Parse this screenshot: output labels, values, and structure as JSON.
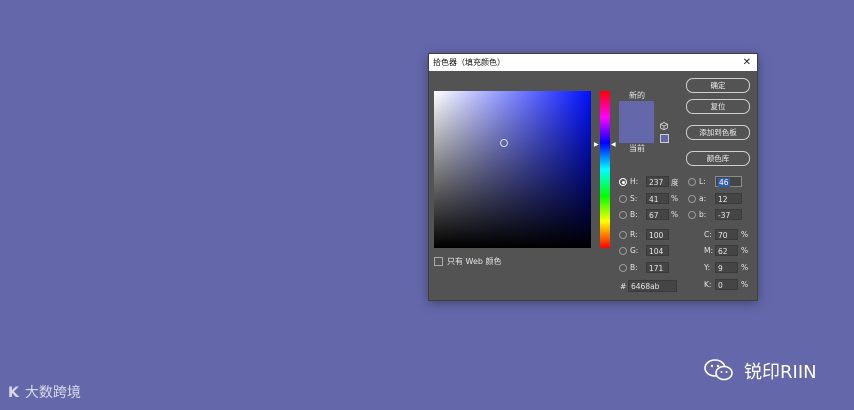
{
  "dialog": {
    "title": "拾色器（填充颜色）",
    "close_glyph": "✕",
    "web_only_label": "只有 Web 颜色",
    "new_label": "新的",
    "current_label": "当前",
    "buttons": {
      "ok": "确定",
      "reset": "复位",
      "add_swatch": "添加到色板",
      "color_libraries": "颜色库"
    },
    "hsb": {
      "h": {
        "label": "H:",
        "value": "237",
        "unit": "度"
      },
      "s": {
        "label": "S:",
        "value": "41",
        "unit": "%"
      },
      "b": {
        "label": "B:",
        "value": "67",
        "unit": "%"
      }
    },
    "rgb": {
      "r": {
        "label": "R:",
        "value": "100"
      },
      "g": {
        "label": "G:",
        "value": "104"
      },
      "b": {
        "label": "B:",
        "value": "171"
      }
    },
    "lab": {
      "l": {
        "label": "L:",
        "value": "46"
      },
      "a": {
        "label": "a:",
        "value": "12"
      },
      "b": {
        "label": "b:",
        "value": "-37"
      }
    },
    "cmyk": {
      "c": {
        "label": "C:",
        "value": "70",
        "unit": "%"
      },
      "m": {
        "label": "M:",
        "value": "62",
        "unit": "%"
      },
      "y": {
        "label": "Y:",
        "value": "9",
        "unit": "%"
      },
      "k": {
        "label": "K:",
        "value": "0",
        "unit": "%"
      }
    },
    "hex": {
      "label": "#",
      "value": "6468ab"
    },
    "selected_color": "#6468ab",
    "selected_channel": "H"
  },
  "watermark": {
    "left_text": "大数跨境",
    "left_logo": "K",
    "right_text": "锐印RIIN"
  },
  "colors": {
    "background": "#6468ab",
    "dialog_bg": "#535353",
    "focus": "#2f5cab"
  }
}
